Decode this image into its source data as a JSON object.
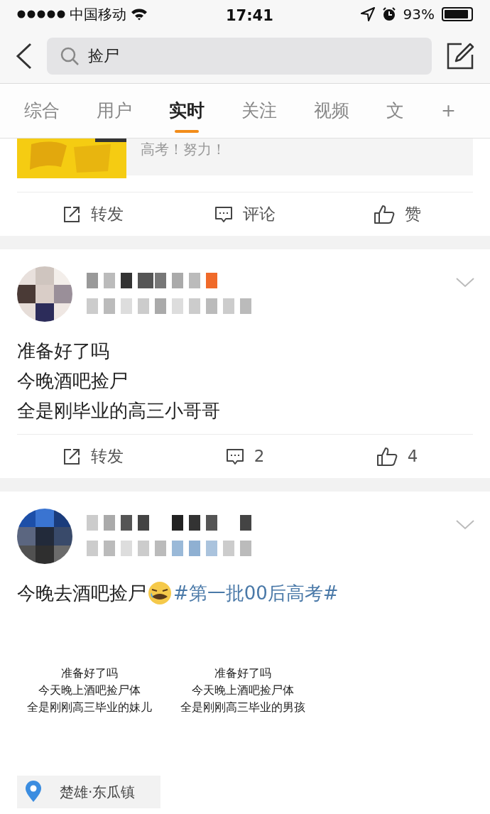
{
  "status_bar": {
    "carrier": "中国移动",
    "time": "17:41",
    "battery": "93%"
  },
  "search": {
    "value": "捡尸"
  },
  "tabs": [
    {
      "label": "综合",
      "selected": false
    },
    {
      "label": "用户",
      "selected": false
    },
    {
      "label": "实时",
      "selected": true
    },
    {
      "label": "关注",
      "selected": false
    },
    {
      "label": "视频",
      "selected": false
    },
    {
      "label": "文",
      "selected": false
    },
    {
      "label": "+",
      "selected": false
    }
  ],
  "posts": [
    {
      "kind": "partial",
      "card_text": "高考！努力！",
      "actions": [
        {
          "kind": "repost",
          "label": "转发"
        },
        {
          "kind": "comment",
          "label": "评论"
        },
        {
          "kind": "like",
          "label": "赞"
        }
      ]
    },
    {
      "kind": "post",
      "lines": [
        "准备好了吗",
        "今晚酒吧捡尸",
        "全是刚毕业的高三小哥哥"
      ],
      "actions": [
        {
          "kind": "repost",
          "label": "转发"
        },
        {
          "kind": "comment",
          "label": "2"
        },
        {
          "kind": "like",
          "label": "4"
        }
      ]
    },
    {
      "kind": "post",
      "lines": [
        "今晚去酒吧捡尸"
      ],
      "hashtag": "#第一批00后高考#",
      "image_captions": [
        [
          "准备好了吗",
          "今天晚上酒吧捡尸体",
          "全是刚刚高三毕业的妹儿"
        ],
        [
          "准备好了吗",
          "今天晚上酒吧捡尸体",
          "全是刚刚高三毕业的男孩"
        ]
      ],
      "location": "楚雄·东瓜镇"
    }
  ]
}
